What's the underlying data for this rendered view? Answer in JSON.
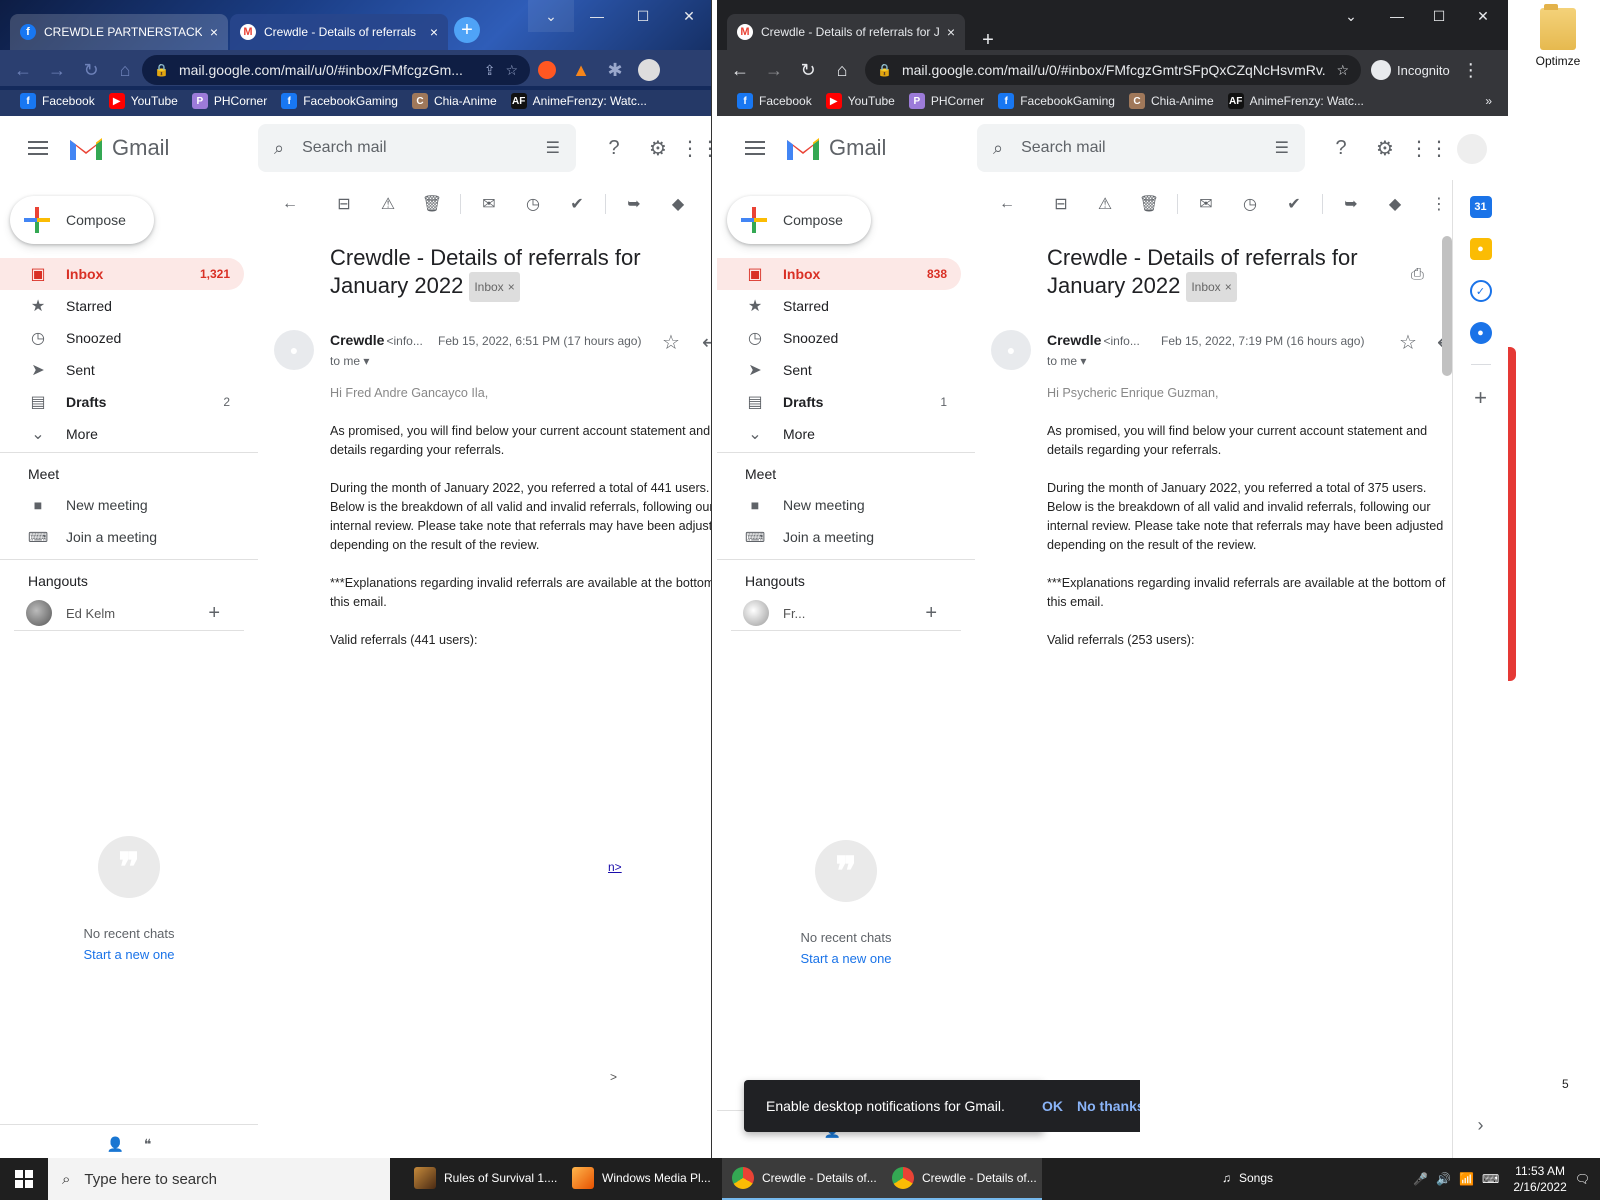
{
  "desktop": {
    "folder_label": "Optimze",
    "stray_digit": "5"
  },
  "window_left": {
    "tabs": [
      {
        "label": "CREWDLE PARTNERSTACK | F",
        "icon": "facebook-icon",
        "close": "×"
      },
      {
        "label": "Crewdle - Details of referrals",
        "icon": "gmail-icon",
        "close": "×"
      }
    ],
    "new_tab": "+",
    "url": "mail.google.com/mail/u/0/#inbox/FMfcgzGm...",
    "bookmarks": [
      "Facebook",
      "YouTube",
      "PHCorner",
      "FacebookGaming",
      "Chia-Anime",
      "AnimeFrenzy: Watc..."
    ],
    "gmail": {
      "logo_text": "Gmail",
      "search_placeholder": "Search mail",
      "compose": "Compose",
      "nav": [
        {
          "label": "Inbox",
          "count": "1,321"
        },
        {
          "label": "Starred",
          "count": ""
        },
        {
          "label": "Snoozed",
          "count": ""
        },
        {
          "label": "Sent",
          "count": ""
        },
        {
          "label": "Drafts",
          "count": "2"
        },
        {
          "label": "More",
          "count": ""
        }
      ],
      "meet_title": "Meet",
      "meet_items": [
        "New meeting",
        "Join a meeting"
      ],
      "hangouts_title": "Hangouts",
      "hangout_user": "Ed Kelm",
      "no_recent": "No recent chats",
      "start_new": "Start a new one",
      "subject_line1": "Crewdle - Details of referrals for",
      "subject_line2": "January 2022",
      "label_chip": "Inbox",
      "sender": "Crewdle",
      "sender_email": "<info...",
      "date": "Feb 15, 2022, 6:51 PM (17 hours ago)",
      "to_me": "to me",
      "greeting": "Hi Fred Andre Gancayco Ila,",
      "para1_l1": "As promised, you will find below your current account statement and",
      "para1_l2": "details regarding your referrals.",
      "para2_l1": "During the month of January 2022, you referred a total of 441 users.",
      "para2_l2": "Below is the breakdown of all valid and invalid referrals, following our",
      "para2_l3": "internal review. Please take note that referrals may have been adjusted",
      "para2_l4": "depending on the result of the review.",
      "para3_l1": "***Explanations regarding invalid referrals are available at the bottom of",
      "para3_l2": "this email.",
      "valid": "Valid referrals (441 users):",
      "stray1": "n>",
      "stray2": ">"
    }
  },
  "window_right": {
    "tabs": [
      {
        "label": "Crewdle - Details of referrals for J",
        "icon": "gmail-icon",
        "close": "×"
      }
    ],
    "new_tab": "+",
    "url": "mail.google.com/mail/u/0/#inbox/FMfcgzGmtrSFpQxCZqNcHsvmRv...",
    "incognito": "Incognito",
    "bookmarks": [
      "Facebook",
      "YouTube",
      "PHCorner",
      "FacebookGaming",
      "Chia-Anime",
      "AnimeFrenzy: Watc..."
    ],
    "more_bookmarks": "»",
    "gmail": {
      "logo_text": "Gmail",
      "search_placeholder": "Search mail",
      "compose": "Compose",
      "nav": [
        {
          "label": "Inbox",
          "count": "838"
        },
        {
          "label": "Starred",
          "count": ""
        },
        {
          "label": "Snoozed",
          "count": ""
        },
        {
          "label": "Sent",
          "count": ""
        },
        {
          "label": "Drafts",
          "count": "1"
        },
        {
          "label": "More",
          "count": ""
        }
      ],
      "meet_title": "Meet",
      "meet_items": [
        "New meeting",
        "Join a meeting"
      ],
      "hangouts_title": "Hangouts",
      "hangout_user": "Fr...",
      "no_recent": "No recent chats",
      "start_new": "Start a new one",
      "subject_line1": "Crewdle - Details of referrals for",
      "subject_line2": "January 2022",
      "label_chip": "Inbox",
      "sender": "Crewdle",
      "sender_email": "<info...",
      "date": "Feb 15, 2022, 7:19 PM (16 hours ago)",
      "to_me": "to me",
      "greeting": "Hi Psycheric Enrique Guzman,",
      "para1_l1": "As promised, you will find below your current account statement and",
      "para1_l2": "details regarding your referrals.",
      "para2_l1": "During the month of January 2022, you referred a total of 375 users.",
      "para2_l2": "Below is the breakdown of all valid and invalid referrals, following our",
      "para2_l3": "internal review. Please take note that referrals may have been adjusted",
      "para2_l4": "depending on the result of the review.",
      "para3_l1": "***Explanations regarding invalid referrals are available at the bottom of",
      "para3_l2": "this email.",
      "valid": "Valid referrals (253 users):"
    },
    "notification": {
      "text": "Enable desktop notifications for Gmail.",
      "ok": "OK",
      "no_thanks": "No thanks"
    }
  },
  "taskbar": {
    "search_placeholder": "Type here to search",
    "items": [
      {
        "label": "Rules of Survival 1....",
        "icon": "game-icon"
      },
      {
        "label": "Windows Media Pl...",
        "icon": "media-player-icon"
      },
      {
        "label": "Crewdle - Details of...",
        "icon": "chrome-icon"
      },
      {
        "label": "Crewdle - Details of...",
        "icon": "chrome-icon"
      }
    ],
    "songs": "Songs",
    "time": "11:53 AM",
    "date": "2/16/2022"
  },
  "colors": {
    "gmail_red": "#d93025",
    "active_bg": "#fce8e6",
    "link": "#1a73e8",
    "taskbar": "#1f1f1f"
  }
}
